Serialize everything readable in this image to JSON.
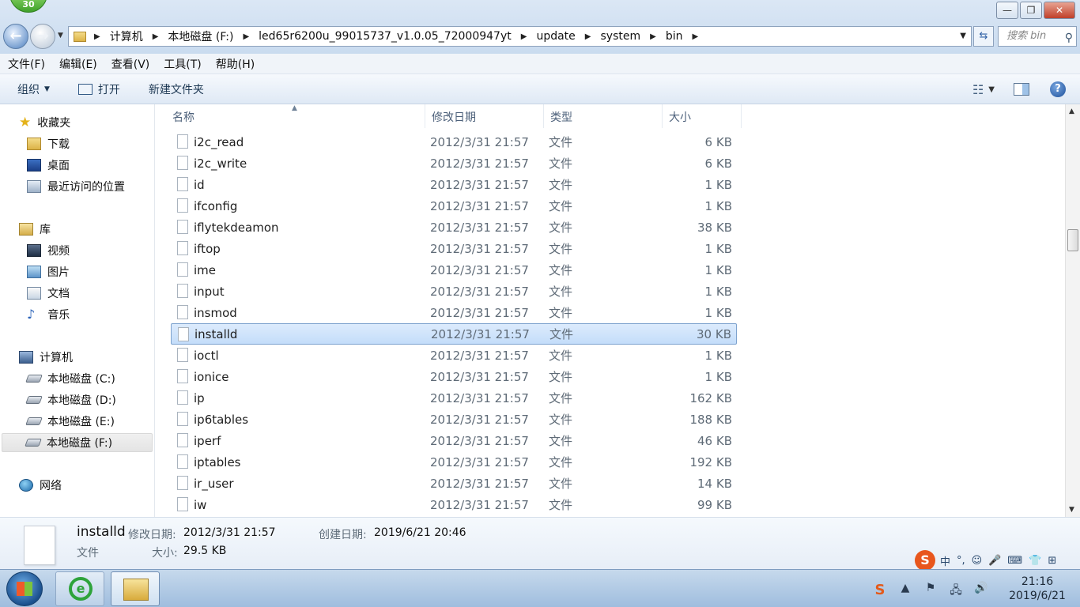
{
  "window": {
    "badge": "30",
    "buttons": {
      "minimize": "—",
      "maximize": "❐",
      "close": "✕"
    }
  },
  "address": {
    "crumbs": [
      "计算机",
      "本地磁盘 (F:)",
      "led65r6200u_99015737_v1.0.05_72000947yt",
      "update",
      "system",
      "bin"
    ],
    "search_placeholder": "搜索 bin"
  },
  "menu": [
    "文件(F)",
    "编辑(E)",
    "查看(V)",
    "工具(T)",
    "帮助(H)"
  ],
  "toolbar": {
    "organize": "组织",
    "open": "打开",
    "new_folder": "新建文件夹"
  },
  "nav": {
    "favorites": "收藏夹",
    "downloads": "下载",
    "desktop": "桌面",
    "recent": "最近访问的位置",
    "libraries": "库",
    "videos": "视频",
    "pictures": "图片",
    "documents": "文档",
    "music": "音乐",
    "computer": "计算机",
    "drive_c": "本地磁盘 (C:)",
    "drive_d": "本地磁盘 (D:)",
    "drive_e": "本地磁盘 (E:)",
    "drive_f": "本地磁盘 (F:)",
    "network": "网络"
  },
  "columns": {
    "name": "名称",
    "date": "修改日期",
    "type": "类型",
    "size": "大小"
  },
  "files": [
    {
      "name": "i2c_read",
      "date": "2012/3/31 21:57",
      "type": "文件",
      "size": "6 KB"
    },
    {
      "name": "i2c_write",
      "date": "2012/3/31 21:57",
      "type": "文件",
      "size": "6 KB"
    },
    {
      "name": "id",
      "date": "2012/3/31 21:57",
      "type": "文件",
      "size": "1 KB"
    },
    {
      "name": "ifconfig",
      "date": "2012/3/31 21:57",
      "type": "文件",
      "size": "1 KB"
    },
    {
      "name": "iflytekdeamon",
      "date": "2012/3/31 21:57",
      "type": "文件",
      "size": "38 KB"
    },
    {
      "name": "iftop",
      "date": "2012/3/31 21:57",
      "type": "文件",
      "size": "1 KB"
    },
    {
      "name": "ime",
      "date": "2012/3/31 21:57",
      "type": "文件",
      "size": "1 KB"
    },
    {
      "name": "input",
      "date": "2012/3/31 21:57",
      "type": "文件",
      "size": "1 KB"
    },
    {
      "name": "insmod",
      "date": "2012/3/31 21:57",
      "type": "文件",
      "size": "1 KB"
    },
    {
      "name": "installd",
      "date": "2012/3/31 21:57",
      "type": "文件",
      "size": "30 KB"
    },
    {
      "name": "ioctl",
      "date": "2012/3/31 21:57",
      "type": "文件",
      "size": "1 KB"
    },
    {
      "name": "ionice",
      "date": "2012/3/31 21:57",
      "type": "文件",
      "size": "1 KB"
    },
    {
      "name": "ip",
      "date": "2012/3/31 21:57",
      "type": "文件",
      "size": "162 KB"
    },
    {
      "name": "ip6tables",
      "date": "2012/3/31 21:57",
      "type": "文件",
      "size": "188 KB"
    },
    {
      "name": "iperf",
      "date": "2012/3/31 21:57",
      "type": "文件",
      "size": "46 KB"
    },
    {
      "name": "iptables",
      "date": "2012/3/31 21:57",
      "type": "文件",
      "size": "192 KB"
    },
    {
      "name": "ir_user",
      "date": "2012/3/31 21:57",
      "type": "文件",
      "size": "14 KB"
    },
    {
      "name": "iw",
      "date": "2012/3/31 21:57",
      "type": "文件",
      "size": "99 KB"
    }
  ],
  "selected_index": 9,
  "details": {
    "name": "installd",
    "modified_label": "修改日期:",
    "modified_value": "2012/3/31 21:57",
    "created_label": "创建日期:",
    "created_value": "2019/6/21 20:46",
    "type": "文件",
    "size_label": "大小:",
    "size_value": "29.5 KB"
  },
  "taskbar": {
    "time": "21:16",
    "date": "2019/6/21"
  },
  "ime_bar": {
    "logo": "S",
    "mode": "中"
  }
}
